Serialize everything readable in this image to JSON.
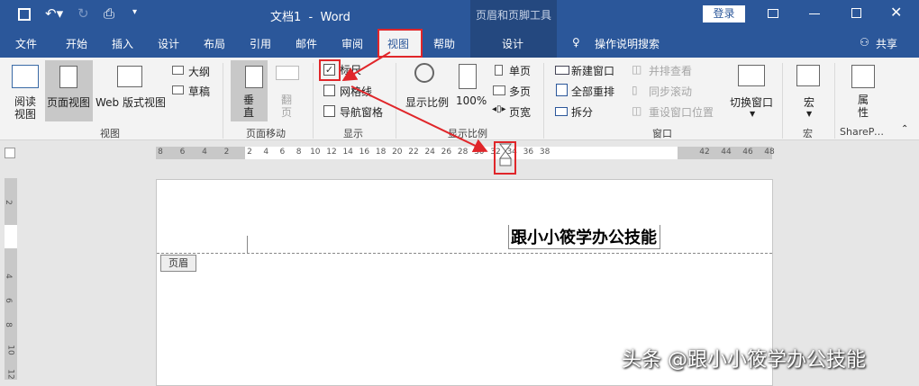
{
  "title_bar": {
    "doc_title": "文档1  -  Word",
    "context_group": "页眉和页脚工具",
    "login": "登录"
  },
  "tabs": [
    "文件",
    "开始",
    "插入",
    "设计",
    "布局",
    "引用",
    "邮件",
    "审阅",
    "视图",
    "帮助"
  ],
  "context_tab": "设计",
  "search": "操作说明搜索",
  "share": "共享",
  "ribbon": {
    "views": {
      "reading": "阅读视图",
      "print": "页面视图",
      "web": "Web 版式视图",
      "outline": "大纲",
      "draft": "草稿",
      "group": "视图"
    },
    "page_move": {
      "vertical": "垂直",
      "flip": "翻页",
      "group": "页面移动"
    },
    "show": {
      "ruler": "标尺",
      "ruler_checked": true,
      "gridlines": "网格线",
      "nav": "导航窗格",
      "group": "显示"
    },
    "zoom": {
      "zoom": "显示比例",
      "hundred": "100%",
      "one": "单页",
      "multi": "多页",
      "width": "页宽",
      "group": "显示比例"
    },
    "window": {
      "new": "新建窗口",
      "arrange": "全部重排",
      "split": "拆分",
      "side": "并排查看",
      "sync": "同步滚动",
      "reset": "重设窗口位置",
      "switch": "切换窗口",
      "group": "窗口"
    },
    "macro": {
      "label": "宏",
      "group": "宏"
    },
    "sharepoint": {
      "label": "属性",
      "group": "SharePoint..."
    }
  },
  "ruler": {
    "left": [
      "8",
      "6",
      "4",
      "2"
    ],
    "main": [
      "2",
      "4",
      "6",
      "8",
      "10",
      "12",
      "14",
      "16",
      "18",
      "20",
      "22",
      "24",
      "26",
      "28",
      "30",
      "32",
      "34",
      "36",
      "38"
    ],
    "right": [
      "42",
      "44",
      "46",
      "48"
    ],
    "vertical": [
      "2",
      "4",
      "6",
      "8",
      "10",
      "12"
    ]
  },
  "document": {
    "header_text": "跟小小筱学办公技能",
    "header_tag": "页眉"
  },
  "watermark": "头条 @跟小小筱学办公技能"
}
